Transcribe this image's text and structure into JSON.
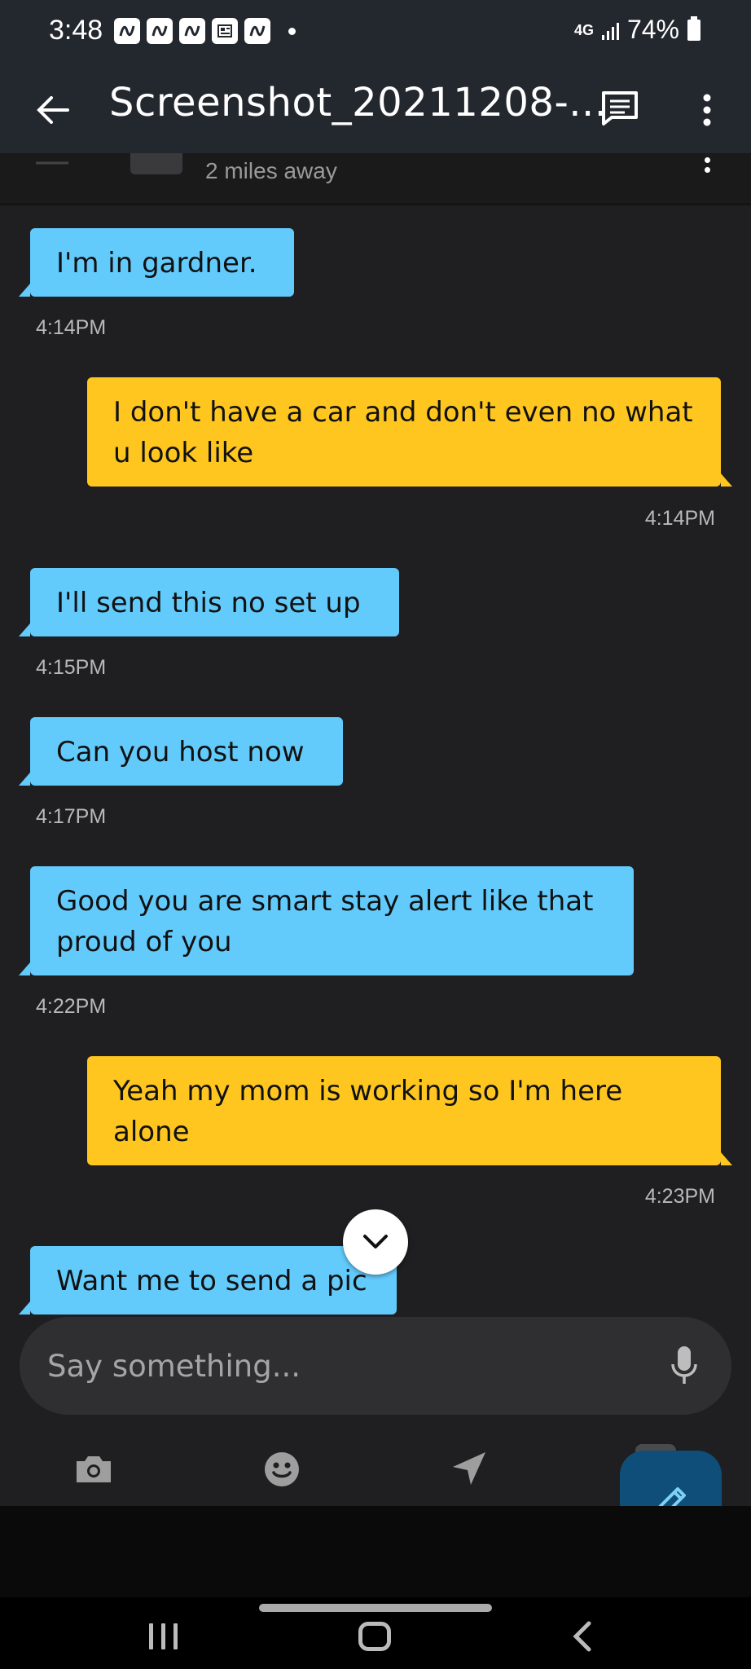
{
  "status_bar": {
    "time": "3:48",
    "network": "4G",
    "battery": "74%",
    "notification_icons": [
      "chat-icon",
      "app-icon",
      "app-icon",
      "app-icon",
      "news-icon",
      "app-icon"
    ]
  },
  "app_bar": {
    "title": "Screenshot_20211208-..."
  },
  "conversation": {
    "distance": "2 miles away"
  },
  "messages": [
    {
      "side": "in",
      "text": "I'm in gardner.",
      "time": "4:14PM"
    },
    {
      "side": "out",
      "text": "I don't have a car and don't even no what u look like",
      "time": "4:14PM"
    },
    {
      "side": "in",
      "text": "I'll send this no set up",
      "time": "4:15PM"
    },
    {
      "side": "in",
      "text": "Can you host now",
      "time": "4:17PM"
    },
    {
      "side": "in",
      "text": "Good you are smart stay alert like that proud of you",
      "time": "4:22PM"
    },
    {
      "side": "out",
      "text": "Yeah my mom is working so I'm here alone",
      "time": "4:23PM"
    },
    {
      "side": "in",
      "text": "Want me to send a pic",
      "time": ""
    }
  ],
  "composer": {
    "placeholder": "Say something..."
  },
  "colors": {
    "incoming_bubble": "#63cbfc",
    "outgoing_bubble": "#fec61f",
    "background": "#1f1f21",
    "fab": "#0e4e78"
  }
}
